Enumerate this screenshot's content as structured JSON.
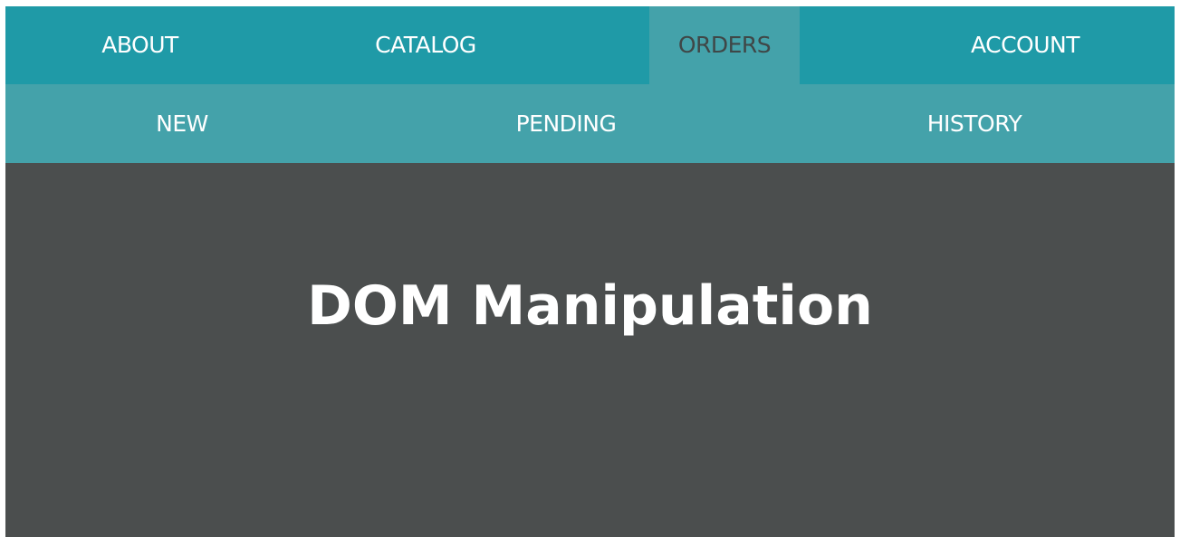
{
  "top_nav": {
    "items": [
      {
        "label": "ABOUT"
      },
      {
        "label": "CATALOG"
      },
      {
        "label": "ORDERS",
        "active": true
      },
      {
        "label": "ACCOUNT"
      }
    ]
  },
  "sub_nav": {
    "items": [
      {
        "label": "NEW"
      },
      {
        "label": "PENDING"
      },
      {
        "label": "HISTORY"
      }
    ]
  },
  "main": {
    "title": "DOM Manipulation"
  },
  "colors": {
    "top_nav_bg": "#1f9aa7",
    "sub_nav_bg": "#44a2aa",
    "active_tab_bg": "#44a2aa",
    "active_tab_text": "#3f4747",
    "content_bg": "#4b4e4e",
    "text": "#ffffff"
  }
}
